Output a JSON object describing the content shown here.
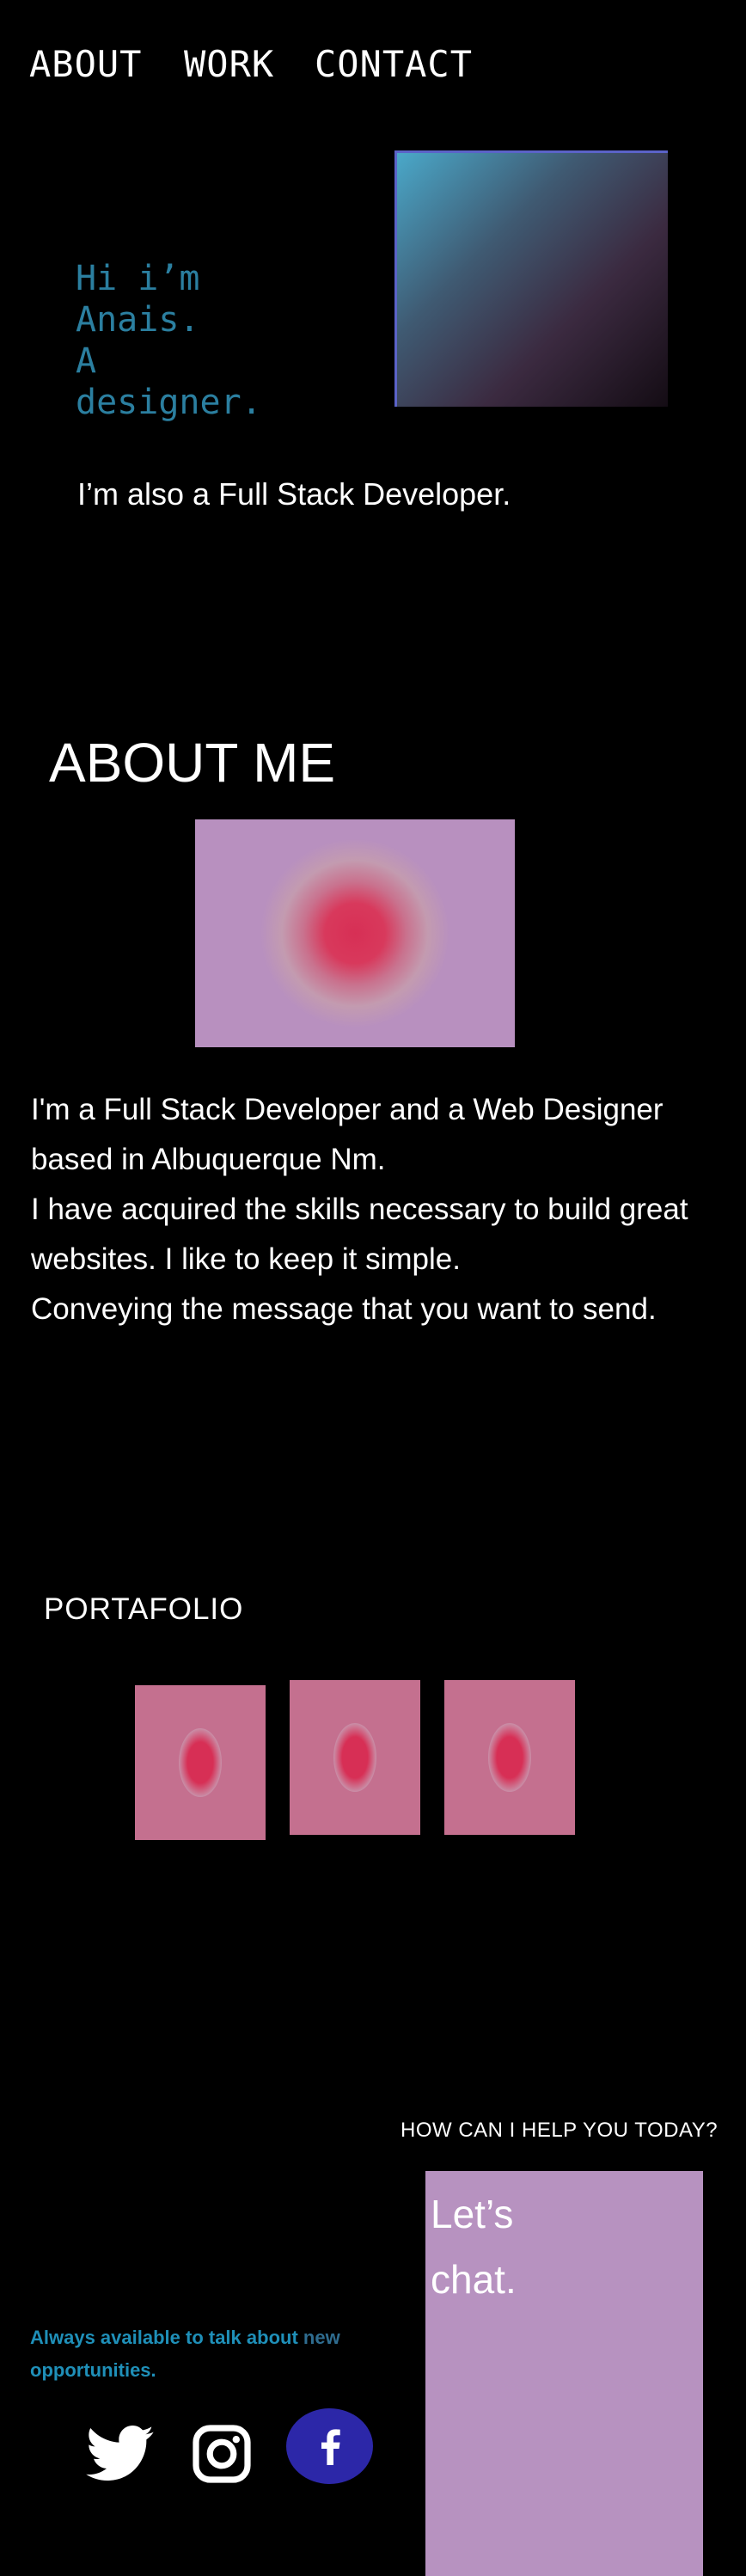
{
  "nav": {
    "about": "ABOUT",
    "work": "WORK",
    "contact": "CONTACT"
  },
  "hero": {
    "greeting_lines": [
      "Hi i’m",
      "Anais.",
      "A",
      "designer."
    ],
    "subtitle": "I’m also a Full Stack Developer."
  },
  "about": {
    "heading": "ABOUT ME",
    "paragraphs": [
      "I'm a Full Stack Developer and a Web Designer based in Albuquerque Nm.",
      "I have acquired the skills necessary to build great websites. I like to keep it simple.",
      "Conveying the message that you want to send."
    ]
  },
  "portfolio": {
    "heading": "PORTAFOLIO"
  },
  "contact": {
    "heading": "HOW CAN I HELP YOU TODAY?",
    "chat_line1": "Let’s",
    "chat_line2": "chat.",
    "available_main": "Always available to talk about",
    "available_muted": "new",
    "available_tail": "opportunities.",
    "social_icons": [
      "twitter-icon",
      "instagram-icon",
      "facebook-icon"
    ]
  },
  "colors": {
    "background": "#000000",
    "greeting": "#2b7fa0",
    "tile": "#b890bf",
    "accent_red": "#d72f55",
    "facebook": "#2c27a8",
    "available": "#1f8fb8"
  }
}
